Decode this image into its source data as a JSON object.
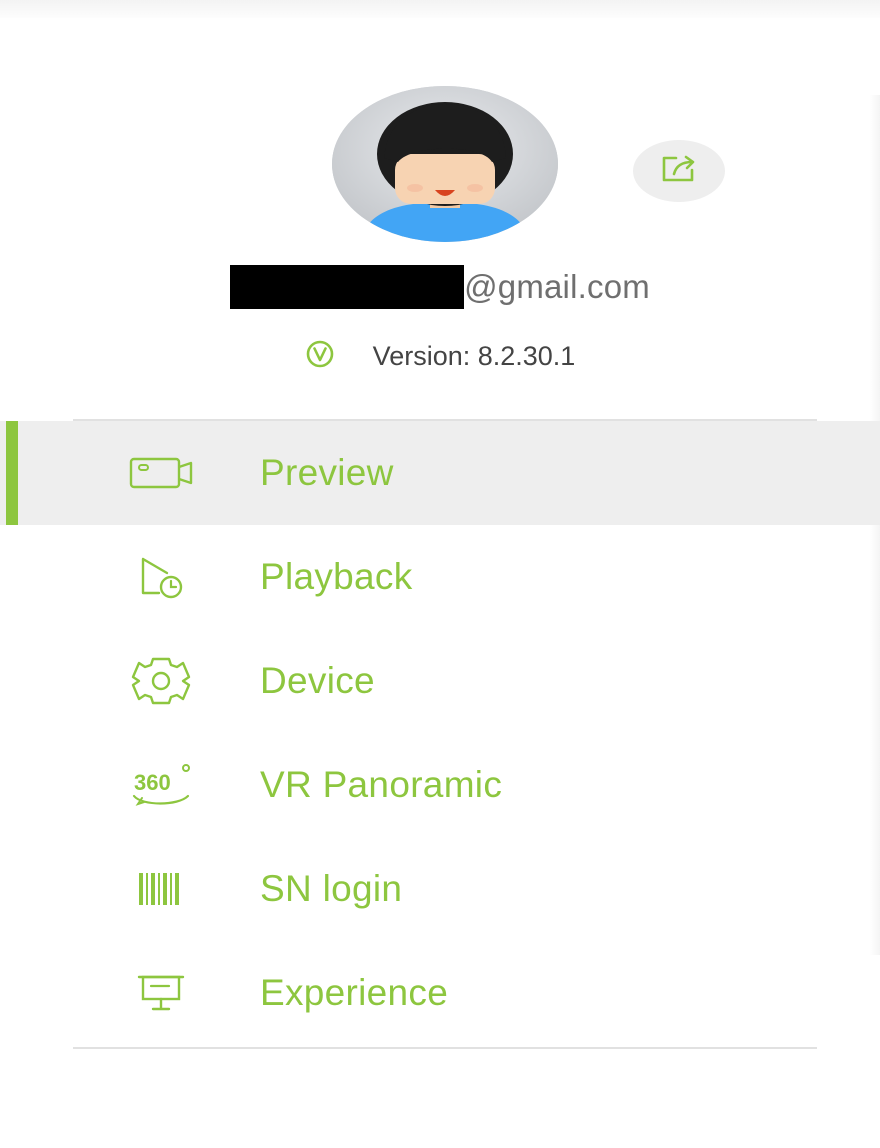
{
  "header": {
    "email_suffix": "@gmail.com",
    "version_text": "Version: 8.2.30.1"
  },
  "theme": {
    "accent": "#8dc63f",
    "active_bg": "#eeeeee",
    "divider": "#e1e1e1"
  },
  "icons": {
    "avatar": "user-avatar",
    "share": "share-icon",
    "version": "version-v-icon"
  },
  "menu": {
    "items": [
      {
        "label": "Preview",
        "icon": "camera-icon",
        "active": true
      },
      {
        "label": "Playback",
        "icon": "playback-clock-icon",
        "active": false
      },
      {
        "label": "Device",
        "icon": "gear-icon",
        "active": false
      },
      {
        "label": "VR Panoramic",
        "icon": "360-icon",
        "active": false
      },
      {
        "label": "SN login",
        "icon": "barcode-icon",
        "active": false
      },
      {
        "label": "Experience",
        "icon": "presentation-screen-icon",
        "active": false
      }
    ]
  }
}
